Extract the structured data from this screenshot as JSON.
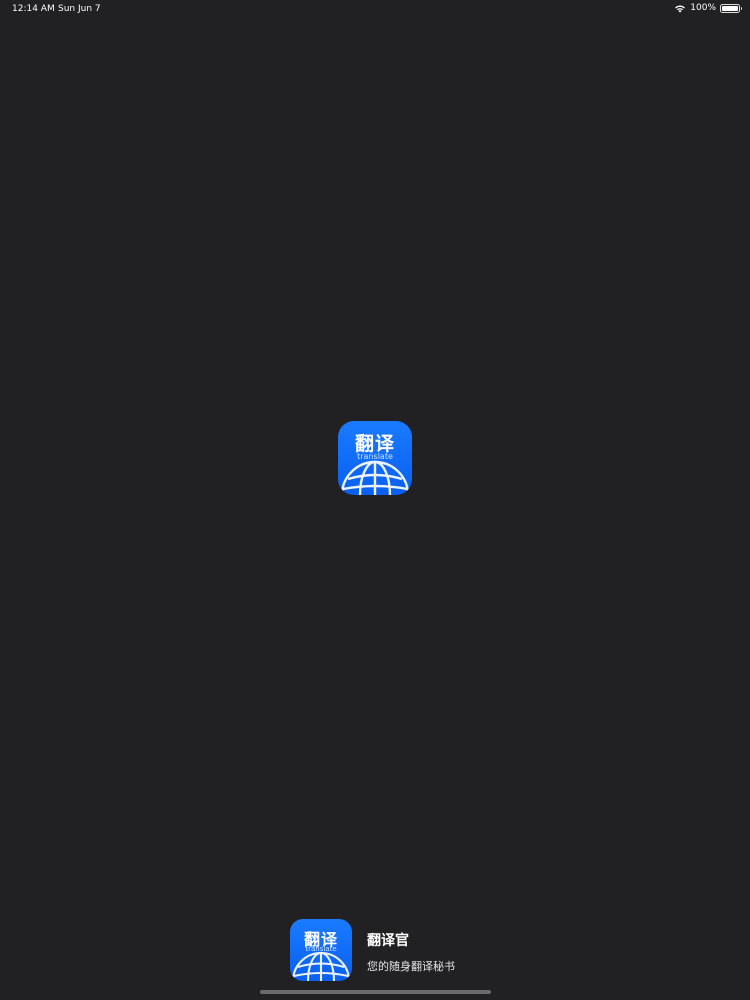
{
  "status_bar": {
    "time": "12:14 AM",
    "date": "Sun Jun 7",
    "battery_percent": "100%",
    "battery_level": 1.0,
    "icons": [
      "wifi-icon",
      "battery-icon"
    ]
  },
  "splash": {
    "icon": {
      "title_cn": "翻译",
      "subtitle_en": "translate",
      "colors": {
        "background": "#0a6cff",
        "globe": "#ffffff"
      }
    }
  },
  "footer": {
    "app_name": "翻译官",
    "slogan": "您的随身翻译秘书"
  },
  "colors": {
    "background": "#212123",
    "home_indicator": "#6b6b6e"
  }
}
